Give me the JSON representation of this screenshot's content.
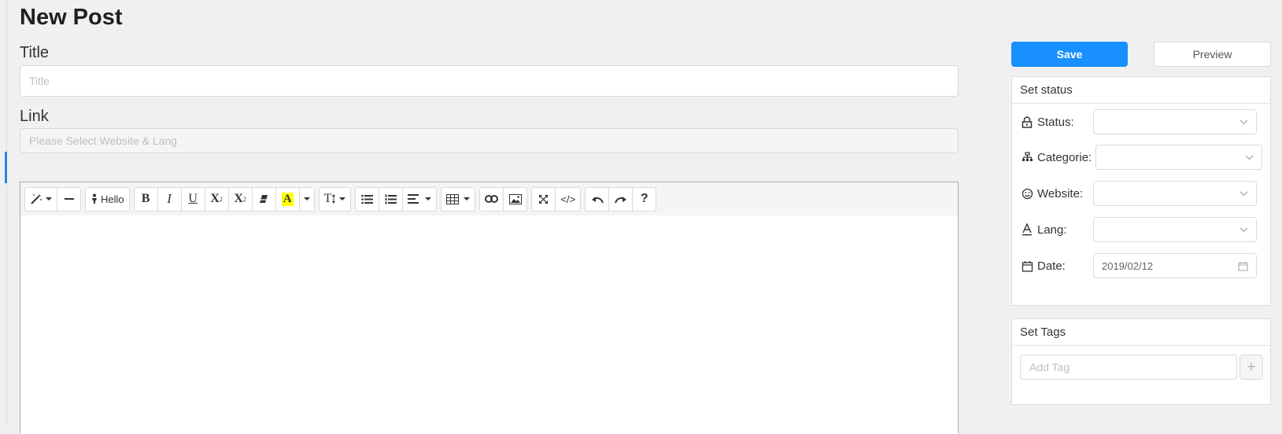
{
  "page": {
    "title": "New Post"
  },
  "form": {
    "title_label": "Title",
    "title_placeholder": "Title",
    "title_value": "",
    "link_label": "Link",
    "link_placeholder": "Please Select Website & Lang",
    "link_value": ""
  },
  "toolbar": {
    "style_icon": "magic-wand-icon",
    "hr_icon": "horizontal-rule-icon",
    "hello_label": "Hello",
    "bold_label": "B",
    "italic_label": "I",
    "underline_label": "U",
    "superscript_label": "X",
    "superscript_mark": "2",
    "subscript_label": "X",
    "subscript_mark": "2",
    "clear_icon": "eraser-icon",
    "color_label": "A",
    "fontsize_label": "T",
    "ul_icon": "unordered-list-icon",
    "ol_icon": "ordered-list-icon",
    "align_icon": "align-left-icon",
    "table_icon": "table-icon",
    "link_icon": "link-icon",
    "image_icon": "image-icon",
    "fullscreen_icon": "fullscreen-icon",
    "code_label": "</>",
    "undo_icon": "undo-icon",
    "redo_icon": "redo-icon",
    "help_label": "?"
  },
  "actions": {
    "save_label": "Save",
    "preview_label": "Preview"
  },
  "status_panel": {
    "header": "Set status",
    "status_label": "Status:",
    "categorie_label": "Categorie:",
    "website_label": "Website:",
    "lang_label": "Lang:",
    "date_label": "Date:",
    "date_value": "2019/02/12"
  },
  "tags_panel": {
    "header": "Set Tags",
    "add_placeholder": "Add Tag",
    "add_button": "+"
  },
  "colors": {
    "accent": "#1890ff",
    "highlight": "#ffff00",
    "background": "#f0f0f0"
  }
}
